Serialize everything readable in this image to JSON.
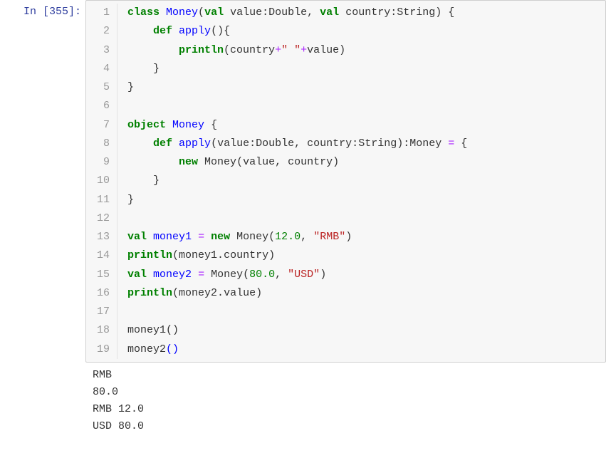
{
  "prompt": {
    "in_label": "In ",
    "exec_count": "[355]:",
    "full": "In  [355]:"
  },
  "code_lines": [
    {
      "n": "1",
      "tokens": [
        [
          "kw",
          "class"
        ],
        [
          "sp",
          " "
        ],
        [
          "def",
          "Money"
        ],
        [
          "punc",
          "("
        ],
        [
          "kw",
          "val"
        ],
        [
          "sp",
          " "
        ],
        [
          "id",
          "value"
        ],
        [
          "punc",
          ":"
        ],
        [
          "id",
          "Double"
        ],
        [
          "punc",
          ","
        ],
        [
          "sp",
          " "
        ],
        [
          "kw",
          "val"
        ],
        [
          "sp",
          " "
        ],
        [
          "id",
          "country"
        ],
        [
          "punc",
          ":"
        ],
        [
          "id",
          "String"
        ],
        [
          "punc",
          ")"
        ],
        [
          "sp",
          " "
        ],
        [
          "punc",
          "{"
        ]
      ]
    },
    {
      "n": "2",
      "tokens": [
        [
          "sp",
          "    "
        ],
        [
          "kw",
          "def"
        ],
        [
          "sp",
          " "
        ],
        [
          "def",
          "apply"
        ],
        [
          "punc",
          "()"
        ],
        [
          "punc",
          "{"
        ]
      ]
    },
    {
      "n": "3",
      "tokens": [
        [
          "sp",
          "        "
        ],
        [
          "kw",
          "println"
        ],
        [
          "punc",
          "("
        ],
        [
          "id",
          "country"
        ],
        [
          "op",
          "+"
        ],
        [
          "str",
          "\" \""
        ],
        [
          "op",
          "+"
        ],
        [
          "id",
          "value"
        ],
        [
          "punc",
          ")"
        ]
      ]
    },
    {
      "n": "4",
      "tokens": [
        [
          "sp",
          "    "
        ],
        [
          "punc",
          "}"
        ]
      ]
    },
    {
      "n": "5",
      "tokens": [
        [
          "punc",
          "}"
        ]
      ]
    },
    {
      "n": "6",
      "tokens": []
    },
    {
      "n": "7",
      "tokens": [
        [
          "kw",
          "object"
        ],
        [
          "sp",
          " "
        ],
        [
          "def",
          "Money"
        ],
        [
          "sp",
          " "
        ],
        [
          "punc",
          "{"
        ]
      ]
    },
    {
      "n": "8",
      "tokens": [
        [
          "sp",
          "    "
        ],
        [
          "kw",
          "def"
        ],
        [
          "sp",
          " "
        ],
        [
          "def",
          "apply"
        ],
        [
          "punc",
          "("
        ],
        [
          "id",
          "value"
        ],
        [
          "punc",
          ":"
        ],
        [
          "id",
          "Double"
        ],
        [
          "punc",
          ","
        ],
        [
          "sp",
          " "
        ],
        [
          "id",
          "country"
        ],
        [
          "punc",
          ":"
        ],
        [
          "id",
          "String"
        ],
        [
          "punc",
          ")"
        ],
        [
          "punc",
          ":"
        ],
        [
          "id",
          "Money"
        ],
        [
          "sp",
          " "
        ],
        [
          "op",
          "="
        ],
        [
          "sp",
          " "
        ],
        [
          "punc",
          "{"
        ]
      ]
    },
    {
      "n": "9",
      "tokens": [
        [
          "sp",
          "        "
        ],
        [
          "kw",
          "new"
        ],
        [
          "sp",
          " "
        ],
        [
          "id",
          "Money"
        ],
        [
          "punc",
          "("
        ],
        [
          "id",
          "value"
        ],
        [
          "punc",
          ","
        ],
        [
          "sp",
          " "
        ],
        [
          "id",
          "country"
        ],
        [
          "punc",
          ")"
        ]
      ]
    },
    {
      "n": "10",
      "tokens": [
        [
          "sp",
          "    "
        ],
        [
          "punc",
          "}"
        ]
      ]
    },
    {
      "n": "11",
      "tokens": [
        [
          "punc",
          "}"
        ]
      ]
    },
    {
      "n": "12",
      "tokens": []
    },
    {
      "n": "13",
      "tokens": [
        [
          "kw",
          "val"
        ],
        [
          "sp",
          " "
        ],
        [
          "def",
          "money1"
        ],
        [
          "sp",
          " "
        ],
        [
          "op",
          "="
        ],
        [
          "sp",
          " "
        ],
        [
          "kw",
          "new"
        ],
        [
          "sp",
          " "
        ],
        [
          "id",
          "Money"
        ],
        [
          "punc",
          "("
        ],
        [
          "num",
          "12.0"
        ],
        [
          "punc",
          ","
        ],
        [
          "sp",
          " "
        ],
        [
          "str",
          "\"RMB\""
        ],
        [
          "punc",
          ")"
        ]
      ]
    },
    {
      "n": "14",
      "tokens": [
        [
          "kw",
          "println"
        ],
        [
          "punc",
          "("
        ],
        [
          "id",
          "money1"
        ],
        [
          "punc",
          "."
        ],
        [
          "id",
          "country"
        ],
        [
          "punc",
          ")"
        ]
      ]
    },
    {
      "n": "15",
      "tokens": [
        [
          "kw",
          "val"
        ],
        [
          "sp",
          " "
        ],
        [
          "def",
          "money2"
        ],
        [
          "sp",
          " "
        ],
        [
          "op",
          "="
        ],
        [
          "sp",
          " "
        ],
        [
          "id",
          "Money"
        ],
        [
          "punc",
          "("
        ],
        [
          "num",
          "80.0"
        ],
        [
          "punc",
          ","
        ],
        [
          "sp",
          " "
        ],
        [
          "str",
          "\"USD\""
        ],
        [
          "punc",
          ")"
        ]
      ]
    },
    {
      "n": "16",
      "tokens": [
        [
          "kw",
          "println"
        ],
        [
          "punc",
          "("
        ],
        [
          "id",
          "money2"
        ],
        [
          "punc",
          "."
        ],
        [
          "id",
          "value"
        ],
        [
          "punc",
          ")"
        ]
      ]
    },
    {
      "n": "17",
      "tokens": []
    },
    {
      "n": "18",
      "tokens": [
        [
          "id",
          "money1"
        ],
        [
          "punc",
          "()"
        ]
      ]
    },
    {
      "n": "19",
      "tokens": [
        [
          "id",
          "money2"
        ],
        [
          "def",
          "()"
        ]
      ]
    }
  ],
  "output_lines": [
    "RMB",
    "80.0",
    "RMB 12.0",
    "USD 80.0"
  ]
}
